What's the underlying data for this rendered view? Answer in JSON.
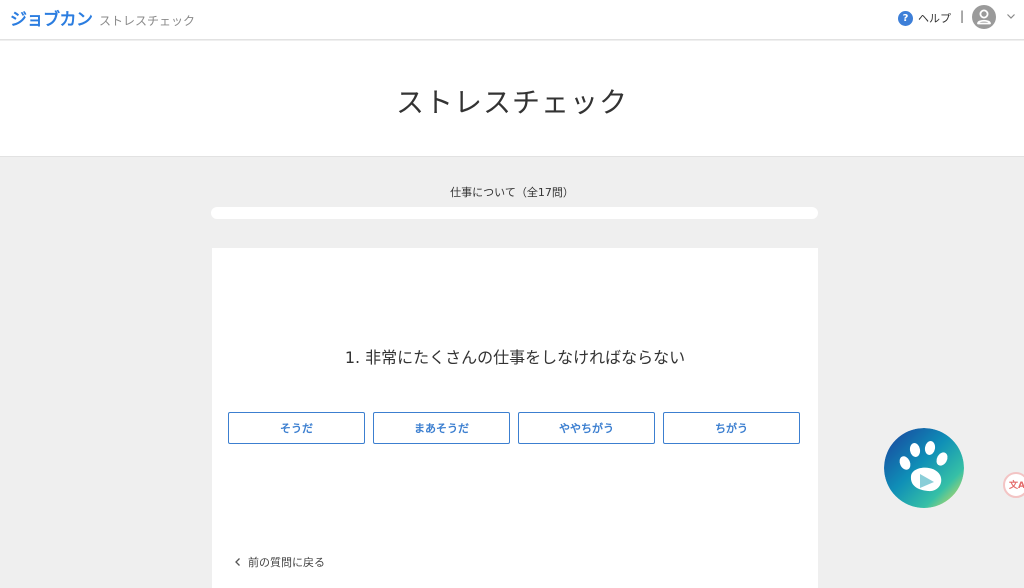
{
  "header": {
    "brand": "ジョブカン",
    "product": "ストレスチェック",
    "help_label": "ヘルプ",
    "separator": "|",
    "icons": {
      "help": "question-circle-icon",
      "user": "user-avatar-icon",
      "menu": "chevron-down-icon"
    }
  },
  "page": {
    "title": "ストレスチェック"
  },
  "survey": {
    "section_label": "仕事について（全17問）",
    "progress_fraction": 0.0,
    "question": "1. 非常にたくさんの仕事をしなければならない",
    "answers": [
      {
        "label": "そうだ"
      },
      {
        "label": "まあそうだ"
      },
      {
        "label": "ややちがう"
      },
      {
        "label": "ちがう"
      }
    ],
    "back_label": "前の質問に戻る"
  },
  "floating": {
    "assistant_icon": "paw-print-icon",
    "side_button_icon": "translate-icon",
    "side_button_text": "文A"
  },
  "colors": {
    "accent_blue": "#3c7fd0",
    "brand_blue": "#2b7de0",
    "background": "#efefef",
    "card": "#ffffff"
  }
}
